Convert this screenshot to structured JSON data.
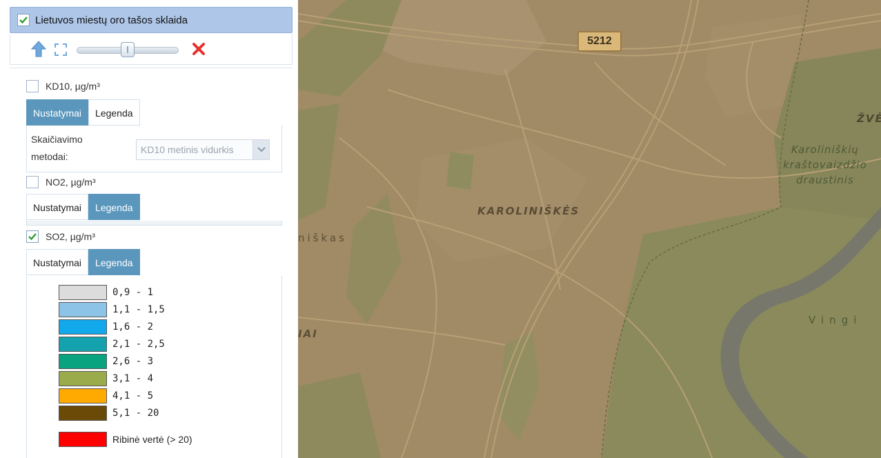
{
  "layer_panel": {
    "title": "Lietuvos miestų oro tašos sklaida",
    "checked": true
  },
  "sublayers": [
    {
      "label": "KD10, µg/m³",
      "checked": false,
      "tabs": [
        "Nustatymai",
        "Legenda"
      ],
      "active_tab": "Nustatymai",
      "settings": {
        "method_label": "Skaičiavimo metodai:",
        "method_value": "KD10 metinis vidurkis"
      }
    },
    {
      "label": "NO2, µg/m³",
      "checked": false,
      "tabs": [
        "Nustatymai",
        "Legenda"
      ],
      "active_tab": "Legenda"
    },
    {
      "label": "SO2, µg/m³",
      "checked": true,
      "tabs": [
        "Nustatymai",
        "Legenda"
      ],
      "active_tab": "Legenda"
    }
  ],
  "legend": [
    {
      "label": "0,9 - 1",
      "color": "#dcdcdc"
    },
    {
      "label": "1,1 - 1,5",
      "color": "#8cc3e6"
    },
    {
      "label": "1,6 - 2",
      "color": "#12a9ec"
    },
    {
      "label": "2,1 - 2,5",
      "color": "#14a3ae"
    },
    {
      "label": "2,6 - 3",
      "color": "#0aa37f"
    },
    {
      "label": "3,1 - 4",
      "color": "#9aab4c"
    },
    {
      "label": "4,1 - 5",
      "color": "#ffaa00"
    },
    {
      "label": "5,1 - 20",
      "color": "#6b4a07"
    },
    {
      "label": "Ribinė vertė (> 20)",
      "color": "#ff0000"
    }
  ],
  "map": {
    "labels": {
      "district": "KAROLINIŠKĖS",
      "reserve_line1": "Karoliniškių",
      "reserve_line2": "kraštovaizdžio",
      "reserve_line3": "draustinis",
      "zv": "ŽVĖ",
      "iskas": "niškas",
      "iai": "IAI",
      "vingi": "Vingi"
    },
    "road_number": "5212",
    "colors": {
      "land": "#a08b66",
      "forest": "#8b8a5c",
      "river": "#77786b",
      "roads": "#b89f76"
    }
  },
  "toolbar": {
    "opacity_percent": 50
  }
}
